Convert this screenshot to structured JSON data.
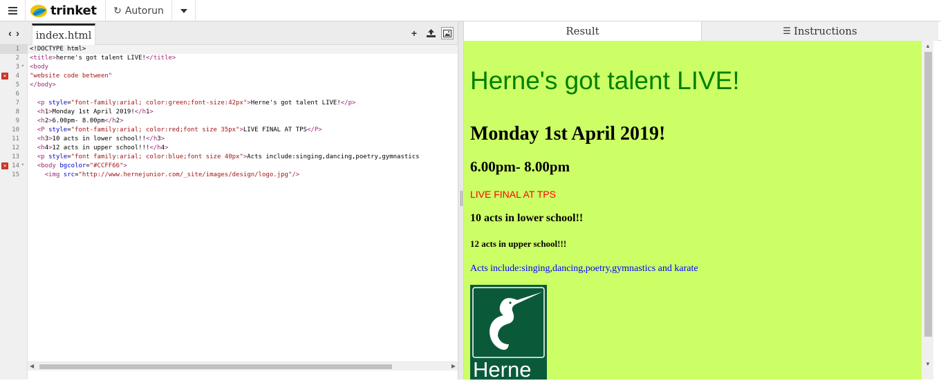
{
  "toolbar": {
    "menu_icon": "hamburger-menu-icon",
    "brand": "trinket",
    "autorun_label": "Autorun",
    "autorun_icon": "refresh-icon",
    "dropdown_icon": "caret-down-icon"
  },
  "editor": {
    "file_tab": "index.html",
    "tools": [
      "plus-icon",
      "upload-icon",
      "image-icon"
    ],
    "line_numbers": [
      "1",
      "2",
      "3",
      "4",
      "5",
      "6",
      "7",
      "8",
      "9",
      "10",
      "11",
      "12",
      "13",
      "14",
      "15"
    ],
    "error_lines": [
      4,
      14
    ],
    "fold_lines": [
      3,
      14
    ],
    "code_lines": [
      "<!DOCTYPE html>",
      "<title>herne's got talent LIVE!</title>",
      "<body",
      "\"website code between\"",
      "</body>",
      "",
      "  <p style=\"font-family:arial; color:green;font-size:42px\">Herne's got talent LIVE!</p>",
      "  <h1>Monday 1st April 2019!</h1>",
      "  <h2>6.00pm- 8.00pm</h2>",
      "  <P style=\"font-family:arial; color:red;font size 35px\">LIVE FINAL AT TPS</P>",
      "  <h3>10 acts in lower school!!</h3>",
      "  <h4>12 acts in upper school!!!</h4>",
      "  <p style=\"font family:arial; color:blue;font size 40px\">Acts include:singing,dancing,poetry,gymnastics",
      "  <body bgcolor=\"#CCFF66\">",
      "    <img src=\"http://www.hernejunior.com/_site/images/design/logo.jpg\"/>"
    ]
  },
  "result_tabs": {
    "result_label": "Result",
    "instructions_label": "Instructions",
    "instructions_icon": "list-icon"
  },
  "rendered": {
    "bgcolor": "#CCFF66",
    "p1": "Herne's got talent LIVE!",
    "h1": "Monday 1st April 2019!",
    "h2": "6.00pm- 8.00pm",
    "p2": "LIVE FINAL AT TPS",
    "h3": "10 acts in lower school!!",
    "h4": "12 acts in upper school!!!",
    "p3": "Acts include:singing,dancing,poetry,gymnastics and karate",
    "logo_text": "Herne"
  }
}
